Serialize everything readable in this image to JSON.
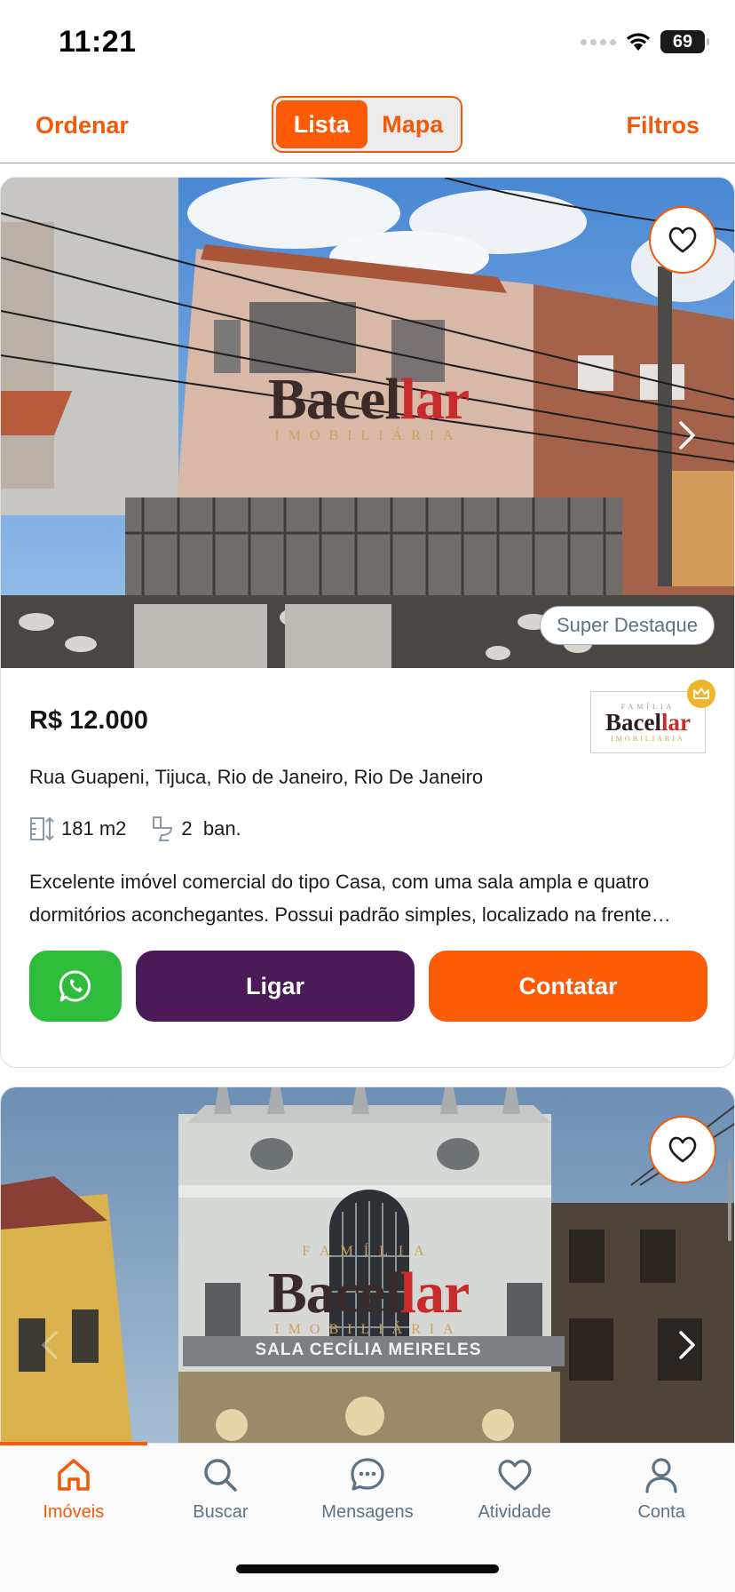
{
  "status_bar": {
    "time": "11:21",
    "battery": "69"
  },
  "toolbar": {
    "sort_label": "Ordenar",
    "view_toggle": {
      "list_label": "Lista",
      "map_label": "Mapa",
      "selected": "Lista"
    },
    "filters_label": "Filtros"
  },
  "colors": {
    "accent": "#fb5a06",
    "call": "#4b1858",
    "whatsapp": "#2dbd3a",
    "badge_text": "#5b7385"
  },
  "listings": [
    {
      "watermark_name": "Bacellar",
      "watermark_sub": "IMOBILIÁRIA",
      "badge": "Super Destaque",
      "price": "R$ 12.000",
      "agency_logo": {
        "top": "FAMÍLIA",
        "name": "Bacellar",
        "bottom": "IMOBILIÁRIA"
      },
      "address": "Rua Guapeni, Tijuca, Rio de Janeiro, Rio De Janeiro",
      "area": "181 m2",
      "bathrooms": "2  ban.",
      "description": "Excelente imóvel comercial do tipo Casa, com uma sala ampla e quatro dormitórios aconchegantes. Possui padrão simples, localizado na frente…",
      "actions": {
        "call_label": "Ligar",
        "contact_label": "Contatar"
      }
    },
    {
      "watermark_top": "FAMÍLIA",
      "watermark_name": "Bacellar",
      "watermark_sub": "IMOBILIÁRIA",
      "sign_text": "SALA CECÍLIA MEIRELES"
    }
  ],
  "tabbar": {
    "items": [
      {
        "label": "Imóveis",
        "icon": "home-icon",
        "active": true
      },
      {
        "label": "Buscar",
        "icon": "search-icon",
        "active": false
      },
      {
        "label": "Mensagens",
        "icon": "chat-bubble-icon",
        "active": false
      },
      {
        "label": "Atividade",
        "icon": "heart-icon",
        "active": false
      },
      {
        "label": "Conta",
        "icon": "user-icon",
        "active": false
      }
    ]
  }
}
